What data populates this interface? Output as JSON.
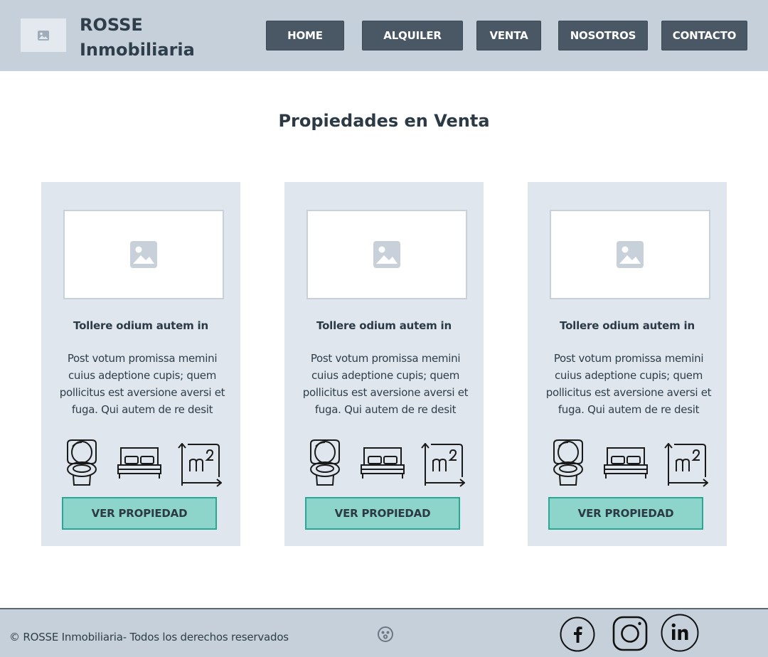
{
  "header": {
    "brand_line1": "ROSSE",
    "brand_line2": "Inmobiliaria",
    "logo_icon": "image-placeholder-icon",
    "nav": [
      {
        "label": "HOME"
      },
      {
        "label": "ALQUILER"
      },
      {
        "label": "VENTA"
      },
      {
        "label": "NOSOTROS"
      },
      {
        "label": "CONTACTO"
      }
    ]
  },
  "main": {
    "title": "Propiedades en Venta",
    "cards": [
      {
        "title": "Tollere odium autem in",
        "text": "Post votum promissa memini cuius adeptione cupis; quem pollicitus est aversione aversi et fuga. Qui autem de re desit",
        "button": "VER PROPIEDAD",
        "feature_icons": [
          "toilet-icon",
          "bed-icon",
          "square-meters-icon"
        ]
      },
      {
        "title": "Tollere odium autem in",
        "text": "Post votum promissa memini cuius adeptione cupis; quem pollicitus est aversione aversi et fuga. Qui autem de re desit",
        "button": "VER PROPIEDAD",
        "feature_icons": [
          "toilet-icon",
          "bed-icon",
          "square-meters-icon"
        ]
      },
      {
        "title": "Tollere odium autem in",
        "text": "Post votum promissa memini cuius adeptione cupis; quem pollicitus est aversione aversi et fuga. Qui autem de re desit",
        "button": "VER PROPIEDAD",
        "feature_icons": [
          "toilet-icon",
          "bed-icon",
          "square-meters-icon"
        ]
      }
    ]
  },
  "footer": {
    "copyright": "© ROSSE Inmobiliaria- Todos los derechos reservados",
    "social_icons": [
      "facebook-icon",
      "instagram-icon",
      "linkedin-icon"
    ]
  },
  "colors": {
    "header_bg": "#c5d0da",
    "nav_button": "#4a5866",
    "card_bg": "#dfe6ee",
    "cta_fill": "#8dd5cb",
    "cta_border": "#27a794"
  }
}
